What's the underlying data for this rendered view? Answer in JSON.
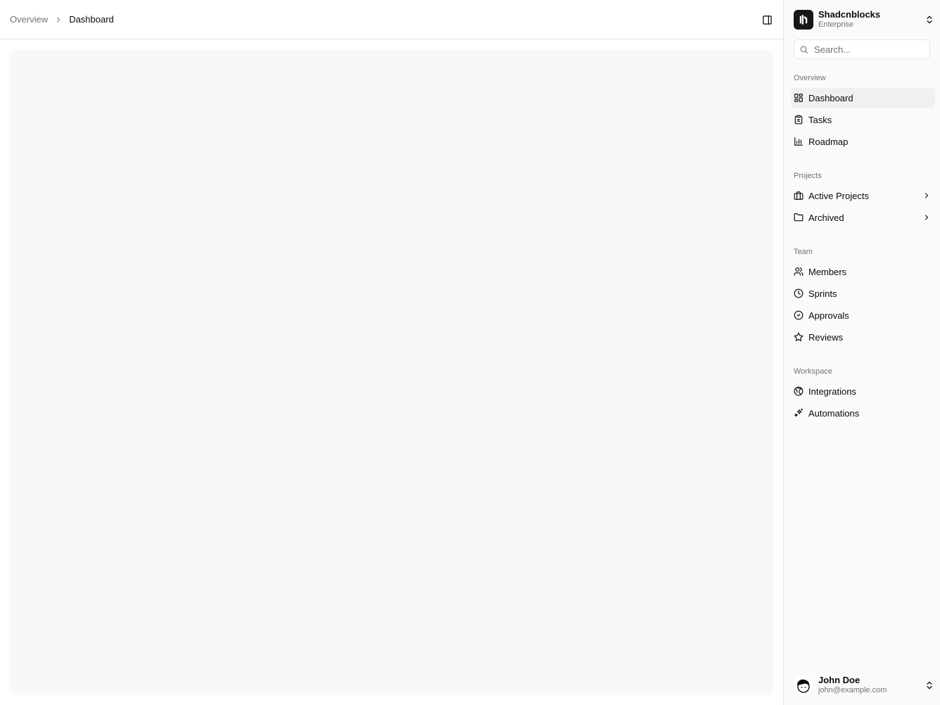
{
  "breadcrumb": {
    "items": [
      {
        "label": "Overview"
      },
      {
        "label": "Dashboard"
      }
    ]
  },
  "team": {
    "name": "Shadcnblocks",
    "plan": "Enterprise"
  },
  "search": {
    "placeholder": "Search..."
  },
  "nav": {
    "groups": [
      {
        "label": "Overview",
        "items": [
          {
            "label": "Dashboard",
            "icon": "layout-dashboard-icon",
            "active": true
          },
          {
            "label": "Tasks",
            "icon": "clipboard-icon"
          },
          {
            "label": "Roadmap",
            "icon": "bar-chart-icon"
          }
        ]
      },
      {
        "label": "Projects",
        "items": [
          {
            "label": "Active Projects",
            "icon": "briefcase-icon",
            "expandable": true
          },
          {
            "label": "Archived",
            "icon": "folder-icon",
            "expandable": true
          }
        ]
      },
      {
        "label": "Team",
        "items": [
          {
            "label": "Members",
            "icon": "users-icon"
          },
          {
            "label": "Sprints",
            "icon": "clock-icon"
          },
          {
            "label": "Approvals",
            "icon": "check-circle-icon"
          },
          {
            "label": "Reviews",
            "icon": "star-icon"
          }
        ]
      },
      {
        "label": "Workspace",
        "items": [
          {
            "label": "Integrations",
            "icon": "globe-icon"
          },
          {
            "label": "Automations",
            "icon": "sparkles-icon"
          }
        ]
      }
    ]
  },
  "user": {
    "name": "John Doe",
    "email": "john@example.com"
  },
  "colors": {
    "sidebar_bg": "#fafafa",
    "content_bg": "#f8f8f8",
    "active_item_bg": "#f0f0f0",
    "border": "#e5e5e5",
    "muted_text": "#737373",
    "text": "#0a0a0a"
  }
}
